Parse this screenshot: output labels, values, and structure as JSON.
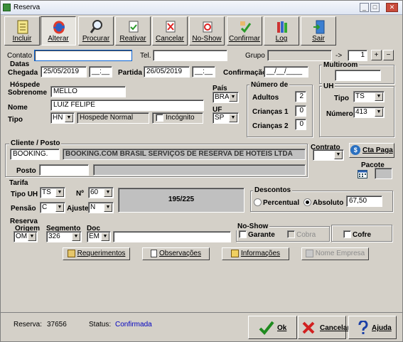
{
  "window": {
    "title": "Reserva",
    "minimize": "_",
    "maximize": "□",
    "close": "✕"
  },
  "toolbar": [
    {
      "label": "Incluir",
      "icon": "notepad-icon"
    },
    {
      "label": "Alterar",
      "icon": "refresh-icon"
    },
    {
      "label": "Procurar",
      "icon": "magnifier-icon"
    },
    {
      "label": "Reativar",
      "icon": "reactivate-icon"
    },
    {
      "label": "Cancelar",
      "icon": "cancel-doc-icon"
    },
    {
      "label": "No-Show",
      "icon": "noshow-icon"
    },
    {
      "label": "Confirmar",
      "icon": "confirm-icon"
    },
    {
      "label": "Log",
      "icon": "books-icon"
    },
    {
      "label": "Sair",
      "icon": "exit-door-icon"
    }
  ],
  "contact": {
    "label": "Contato",
    "value": "",
    "tel_label": "Tel.",
    "tel_value": "",
    "group_label": "Grupo",
    "group_value": "",
    "arrow": "->",
    "count": "1",
    "plus": "+",
    "minus": "−"
  },
  "dates": {
    "section": "Datas",
    "checkin_label": "Chegada",
    "checkin_date": "25/05/2019",
    "checkin_time": "__:__",
    "checkout_label": "Partida",
    "checkout_date": "26/05/2019",
    "checkout_time": "__:__",
    "confirm_label": "Confirmação",
    "confirm_date": "__/__/____"
  },
  "multiroom": {
    "label": "Multiroom",
    "value": ""
  },
  "guest": {
    "section": "Hóspede",
    "surname_label": "Sobrenome",
    "surname": "MELLO",
    "name_label": "Nome",
    "name": "LUIZ FELIPE",
    "type_label": "Tipo",
    "type_code": "HN",
    "type_desc": "Hospede Normal",
    "incognito_label": "Incógnito",
    "country_label": "País",
    "country": "BRA",
    "state_label": "UF",
    "state": "SP"
  },
  "occupancy": {
    "section": "Número de",
    "adults_label": "Adultos",
    "adults": "2",
    "children1_label": "Crianças 1",
    "children1": "0",
    "children2_label": "Crianças 2",
    "children2": "0"
  },
  "uh": {
    "section": "UH",
    "type_label": "Tipo",
    "type": "TS",
    "number_label": "Número",
    "number": "413"
  },
  "client": {
    "section": "Cliente / Posto",
    "code": "BOOKING.",
    "name": "BOOKING.COM BRASIL SERVIÇOS DE RESERVA DE HOTEIS LTDA",
    "post_label": "Posto",
    "post_code": "",
    "post_name": "",
    "contract_label": "Contrato",
    "contract": "",
    "cta_label": "Cta Paga",
    "package_label": "Pacote",
    "package": ""
  },
  "rate": {
    "section": "Tarifa",
    "uh_type_label": "Tipo UH",
    "uh_type": "TS",
    "n_label": "Nº",
    "n": "60",
    "pension_label": "Pensão",
    "pension": "C",
    "adjust_label": "Ajuste",
    "adjust": "N",
    "display": "195/225"
  },
  "discounts": {
    "section": "Descontos",
    "percent_label": "Percentual",
    "absolute_label": "Absoluto",
    "value": "67,50"
  },
  "reservation": {
    "section": "Reserva",
    "origin_label": "Origem",
    "origin": "OM",
    "segment_label": "Segmento",
    "segment": "326",
    "doc_label": "Doc",
    "doc_type": "EM",
    "doc_value": ""
  },
  "noshow": {
    "section": "No-Show",
    "guarantee_label": "Garante",
    "charge_label": "Cobra",
    "safe_label": "Cofre"
  },
  "actions": {
    "requirements": "Requerimentos",
    "observations": "Observações",
    "information": "Informações",
    "company_name": "Nome Empresa"
  },
  "status": {
    "reserve_label": "Reserva:",
    "reserve_number": "37656",
    "status_label": "Status:",
    "status_value": "Confirmada",
    "status_color": "#0000c0"
  },
  "footer": {
    "ok": "Ok",
    "cancel": "Cancelar",
    "help": "Ajuda"
  }
}
